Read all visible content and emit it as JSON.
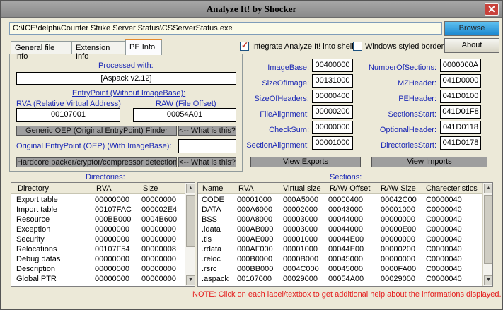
{
  "window": {
    "title": "Analyze It! by Shocker",
    "close_glyph": "✕"
  },
  "toolbar": {
    "path": "C:\\ICE\\delphi\\Counter Strike Server Status\\CSServerStatus.exe",
    "browse_label": "Browse",
    "about_label": "About"
  },
  "tabs": [
    "General file Info",
    "Extension Info",
    "PE Info"
  ],
  "options": {
    "integrate_label": "Integrate Analyze It! into shell",
    "integrate_checked": true,
    "winborder_label": "Windows styled border",
    "winborder_checked": false
  },
  "pe": {
    "processed_label": "Processed with:",
    "processed_value": "[Aspack v2.12]",
    "entry_label": "EntryPoint (Without ImageBase):",
    "rva_label": "RVA (Relative Virtual Address)",
    "raw_label": "RAW (File Offset)",
    "rva_value": "00107001",
    "raw_value": "00054A01",
    "generic_btn": "Generic OEP (Original EntryPoint) Finder",
    "what1": "<-- What is this?",
    "oep_label": "Original EntryPoint (OEP) (With ImageBase):",
    "oep_value": "",
    "hardcore_btn": "Hardcore packer/cryptor/compressor detection",
    "what2": "<-- What is this?"
  },
  "headers": {
    "left": [
      {
        "label": "ImageBase:",
        "value": "00400000"
      },
      {
        "label": "SizeOfImage:",
        "value": "00131000"
      },
      {
        "label": "SizeOfHeaders:",
        "value": "00000400"
      },
      {
        "label": "FileAlignment:",
        "value": "00000200"
      },
      {
        "label": "CheckSum:",
        "value": "00000000"
      },
      {
        "label": "SectionAlignment:",
        "value": "00001000"
      }
    ],
    "right": [
      {
        "label": "NumberOfSections:",
        "value": "0000000A"
      },
      {
        "label": "MZHeader:",
        "value": "041D0000"
      },
      {
        "label": "PEHeader:",
        "value": "041D0100"
      },
      {
        "label": "SectionsStart:",
        "value": "041D01F8"
      },
      {
        "label": "OptionalHeader:",
        "value": "041D0118"
      },
      {
        "label": "DirectoriesStart:",
        "value": "041D0178"
      }
    ],
    "view_exports": "View Exports",
    "view_imports": "View Imports"
  },
  "directories": {
    "title": "Directories:",
    "columns": [
      "Directory",
      "RVA",
      "Size"
    ],
    "rows": [
      [
        "Export table",
        "00000000",
        "00000000"
      ],
      [
        "Import table",
        "00107FAC",
        "000002E4"
      ],
      [
        "Resource",
        "000BB000",
        "0004B600"
      ],
      [
        "Exception",
        "00000000",
        "00000000"
      ],
      [
        "Security",
        "00000000",
        "00000000"
      ],
      [
        "Relocations",
        "00107F54",
        "00000008"
      ],
      [
        "Debug datas",
        "00000000",
        "00000000"
      ],
      [
        "Description",
        "00000000",
        "00000000"
      ],
      [
        "Global PTR",
        "00000000",
        "00000000"
      ]
    ]
  },
  "sections": {
    "title": "Sections:",
    "columns": [
      "Name",
      "RVA",
      "Virtual size",
      "RAW Offset",
      "RAW Size",
      "Charecteristics"
    ],
    "rows": [
      [
        "CODE",
        "00001000",
        "000A5000",
        "00000400",
        "00042C00",
        "C0000040"
      ],
      [
        "DATA",
        "000A6000",
        "00002000",
        "00043000",
        "00001000",
        "C0000040"
      ],
      [
        "BSS",
        "000A8000",
        "00003000",
        "00044000",
        "00000000",
        "C0000040"
      ],
      [
        ".idata",
        "000AB000",
        "00003000",
        "00044000",
        "00000E00",
        "C0000040"
      ],
      [
        ".tls",
        "000AE000",
        "00001000",
        "00044E00",
        "00000000",
        "C0000040"
      ],
      [
        ".rdata",
        "000AF000",
        "00001000",
        "00044E00",
        "00000200",
        "C0000040"
      ],
      [
        ".reloc",
        "000B0000",
        "0000B000",
        "00045000",
        "00000000",
        "C0000040"
      ],
      [
        ".rsrc",
        "000BB000",
        "0004C000",
        "00045000",
        "0000FA00",
        "C0000040"
      ],
      [
        ".aspack",
        "00107000",
        "00029000",
        "00054A00",
        "00029000",
        "C0000040"
      ]
    ]
  },
  "note": "NOTE: Click on each label/textbox to get additional help about the informations displayed."
}
